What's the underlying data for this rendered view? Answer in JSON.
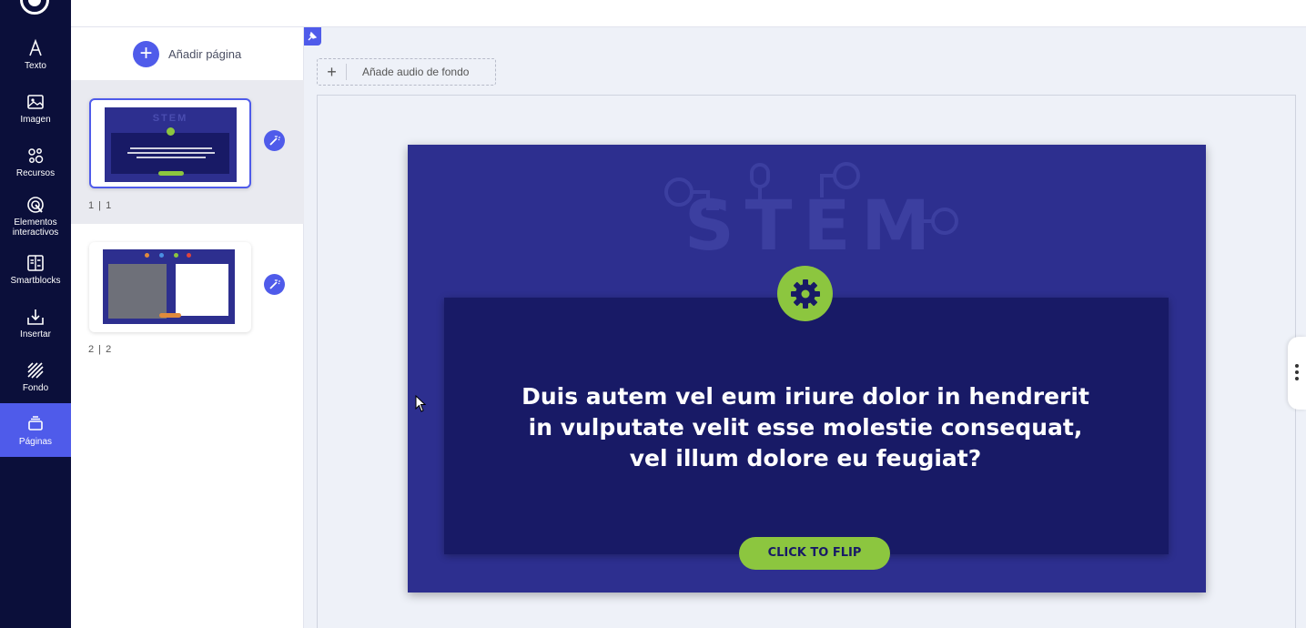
{
  "sidebar": {
    "items": [
      {
        "label": "Texto",
        "icon": "text-icon"
      },
      {
        "label": "Imagen",
        "icon": "image-icon"
      },
      {
        "label": "Recursos",
        "icon": "resources-icon"
      },
      {
        "label": "Elementos interactivos",
        "icon": "interactive-icon"
      },
      {
        "label": "Smartblocks",
        "icon": "smartblocks-icon"
      },
      {
        "label": "Insertar",
        "icon": "insert-icon"
      },
      {
        "label": "Fondo",
        "icon": "background-icon"
      },
      {
        "label": "Páginas",
        "icon": "pages-icon",
        "active": true
      }
    ]
  },
  "pages_panel": {
    "add_page_label": "Añadir página",
    "pages": [
      {
        "number": "1 | 1",
        "selected": true
      },
      {
        "number": "2 | 2",
        "selected": false
      }
    ]
  },
  "workspace": {
    "audio_label": "Añade audio de fondo"
  },
  "slide": {
    "logo_text": "STEM",
    "question": "Duis autem vel eum iriure dolor in hendrerit in vulputate velit esse molestie consequat, vel illum dolore eu feugiat?",
    "button_label": "CLICK TO FLIP"
  },
  "colors": {
    "rail_bg": "#0b0f3a",
    "accent": "#4f5bea",
    "slide_bg": "#2d2f8f",
    "card_bg": "#181a66",
    "green": "#8cc63f"
  }
}
